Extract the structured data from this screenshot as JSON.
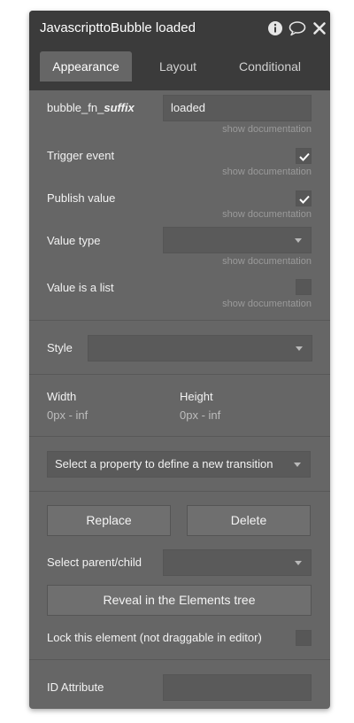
{
  "header": {
    "title": "JavascripttoBubble loaded",
    "icons": [
      "info-icon",
      "comment-icon",
      "close-icon"
    ]
  },
  "tabs": [
    {
      "label": "Appearance",
      "active": true
    },
    {
      "label": "Layout",
      "active": false
    },
    {
      "label": "Conditional",
      "active": false
    }
  ],
  "fields": {
    "suffix": {
      "label_prefix": "bubble_fn_",
      "label_emph": "suffix",
      "value": "loaded",
      "doc": "show documentation"
    },
    "trigger_event": {
      "label": "Trigger event",
      "checked": true,
      "doc": "show documentation"
    },
    "publish_value": {
      "label": "Publish value",
      "checked": true,
      "doc": "show documentation"
    },
    "value_type": {
      "label": "Value type",
      "value": "",
      "doc": "show documentation"
    },
    "value_is_list": {
      "label": "Value is a list",
      "checked": false,
      "doc": "show documentation"
    }
  },
  "style": {
    "label": "Style",
    "value": ""
  },
  "size": {
    "width_label": "Width",
    "width_value": "0px - inf",
    "height_label": "Height",
    "height_value": "0px - inf"
  },
  "transition": {
    "placeholder": "Select a property to define a new transition"
  },
  "buttons": {
    "replace": "Replace",
    "delete": "Delete",
    "reveal": "Reveal in the Elements tree"
  },
  "parent_child": {
    "label": "Select parent/child",
    "value": ""
  },
  "lock": {
    "label": "Lock this element (not draggable in editor)",
    "checked": false
  },
  "id_attribute": {
    "label": "ID Attribute",
    "value": ""
  }
}
